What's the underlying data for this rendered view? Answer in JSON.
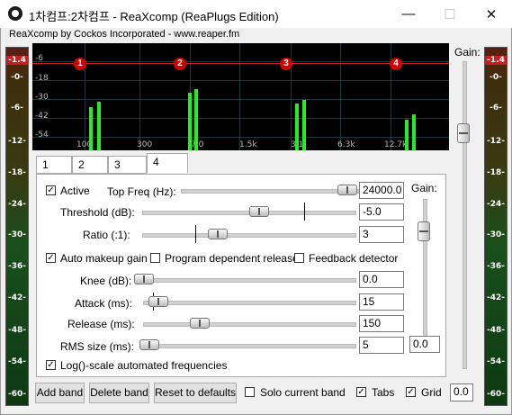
{
  "window": {
    "title": "1차컴프:2차컴프 - ReaXcomp (ReaPlugs Edition)",
    "credit": "ReaXcomp by Cockos Incorporated - www.reaper.fm",
    "controls": [
      "—",
      "☐",
      "✕"
    ]
  },
  "meters": {
    "left_labels": [
      "-1.4",
      "-0-",
      "-6-",
      "-12-",
      "-18-",
      "-24-",
      "-30-",
      "-36-",
      "-42-",
      "-48-",
      "-54-",
      "-60-"
    ],
    "right_labels": [
      "-1.4",
      "-0-",
      "-6-",
      "-12-",
      "-18-",
      "-24-",
      "-30-",
      "-36-",
      "-42-",
      "-48-",
      "-54-",
      "-60-"
    ]
  },
  "graph": {
    "y_labels": [
      "-6",
      "-18",
      "-30",
      "-42",
      "-54"
    ],
    "x_labels": [
      "100",
      "300",
      "7.0",
      "1.5k",
      "3.1",
      "6.3k",
      "12.7k"
    ],
    "bands": [
      "1",
      "2",
      "3",
      "4"
    ]
  },
  "tabs": [
    "1",
    "2",
    "3",
    "4"
  ],
  "band": {
    "active_label": "Active",
    "active": true,
    "top_freq_label": "Top Freq (Hz):",
    "top_freq": "24000.0",
    "threshold_label": "Threshold (dB):",
    "threshold": "-5.0",
    "ratio_label": "Ratio (:1):",
    "ratio": "3",
    "auto_makeup_label": "Auto makeup gain",
    "auto_makeup": true,
    "program_dependent_label": "Program dependent release",
    "program_dependent": false,
    "feedback_label": "Feedback detector",
    "feedback": false,
    "knee_label": "Knee (dB):",
    "knee": "0.0",
    "attack_label": "Attack (ms):",
    "attack": "15",
    "release_label": "Release (ms):",
    "release": "150",
    "rms_label": "RMS size (ms):",
    "rms": "5",
    "gain_label": "Gain:",
    "gain": "0.0",
    "log_label": "Log()-scale automated frequencies",
    "log": true
  },
  "output": {
    "gain_label": "Gain:",
    "gain": "0.0"
  },
  "bottom": {
    "add_band": "Add band",
    "delete_band": "Delete band",
    "reset": "Reset to defaults",
    "solo_label": "Solo current band",
    "solo": false,
    "tabs_label": "Tabs",
    "tabs": true,
    "grid_label": "Grid",
    "grid": true
  },
  "colors": {
    "meter_red": "#cc1c1c",
    "graph_bg": "#000000",
    "bar_green": "#22ee22",
    "node_red": "#d40000"
  },
  "icons": [
    "app-icon",
    "minimize-icon",
    "maximize-icon",
    "close-icon",
    "checkmark-icon"
  ]
}
